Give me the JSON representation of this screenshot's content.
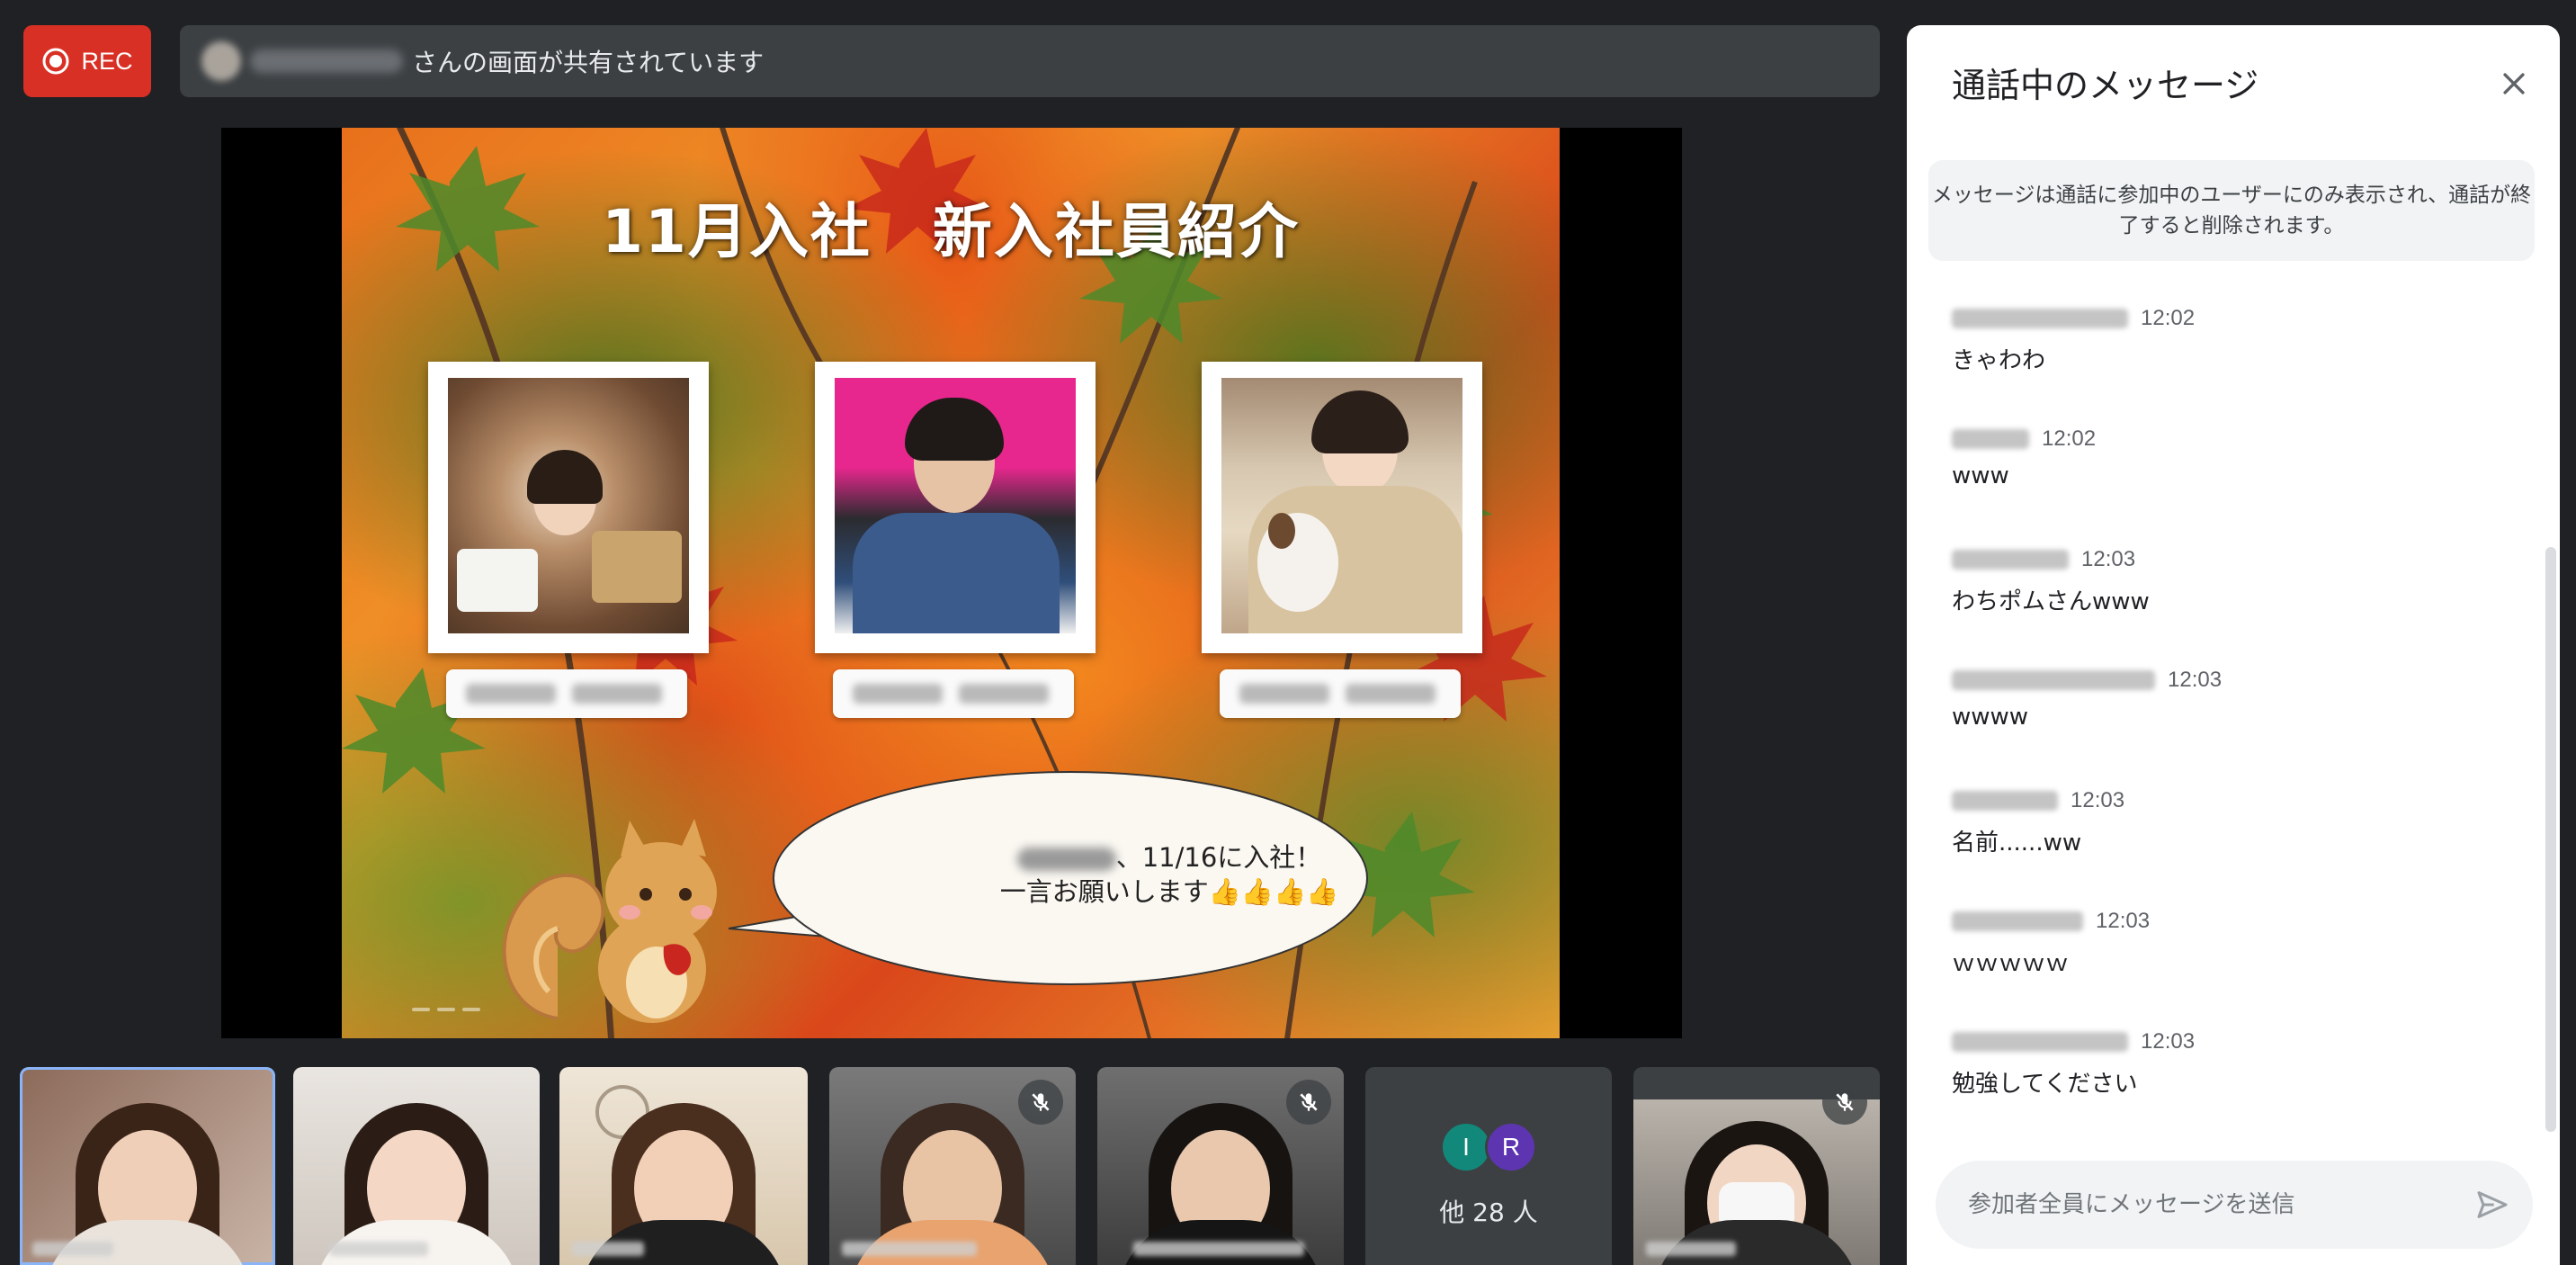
{
  "recording": {
    "label": "REC"
  },
  "share_banner": {
    "suffix_text": "さんの画面が共有されています"
  },
  "slide": {
    "title": "11月入社　新入社員紹介",
    "speech_line1": "、11/16に入社！",
    "speech_line2": "一言お願いします👍👍👍👍"
  },
  "participants": {
    "others_avatars": [
      "I",
      "R"
    ],
    "others_count_label": "他 28 人"
  },
  "chat": {
    "title": "通話中のメッセージ",
    "notice": "メッセージは通話に参加中のユーザーにのみ表示され、通話が終了すると削除されます。",
    "messages": [
      {
        "time": "12:02",
        "text": "きゃわわ"
      },
      {
        "time": "12:02",
        "text": "www"
      },
      {
        "time": "12:03",
        "text": "わちポムさんwww"
      },
      {
        "time": "12:03",
        "text": "wwww"
      },
      {
        "time": "12:03",
        "text": "名前......ww"
      },
      {
        "time": "12:03",
        "text": "ｗｗｗｗｗ"
      },
      {
        "time": "12:03",
        "text": "勉強してください"
      }
    ],
    "input_placeholder": "参加者全員にメッセージを送信"
  },
  "colors": {
    "background": "#202124",
    "rec_red": "#d93025",
    "avatar_i": "#12887a",
    "avatar_r": "#5e35b1",
    "panel": "#ffffff"
  },
  "icons": [
    "record-icon",
    "close-icon",
    "mic-off-icon",
    "send-icon"
  ]
}
